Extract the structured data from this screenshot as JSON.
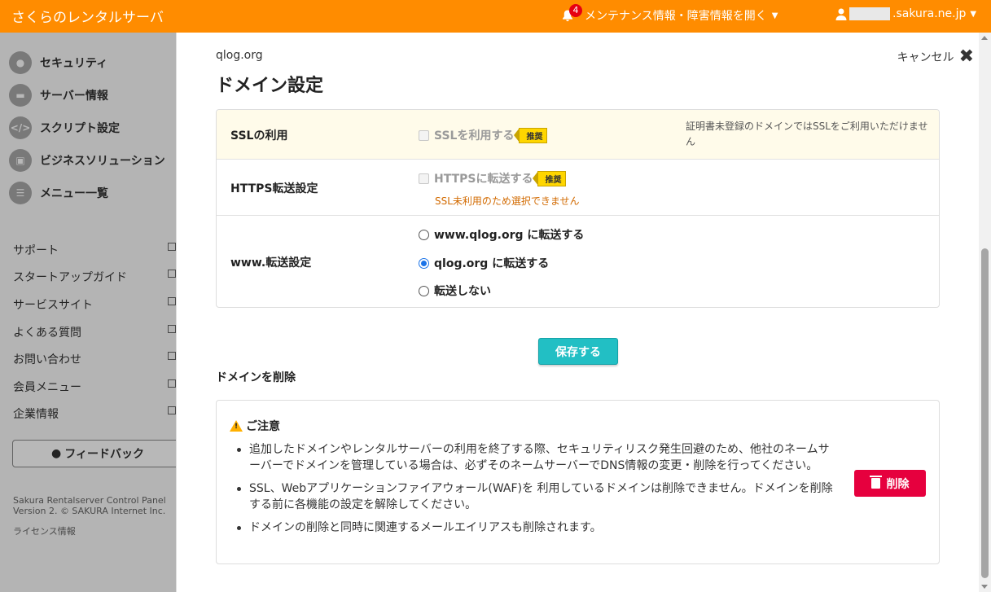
{
  "topbar": {
    "brand": "さくらのレンタルサーバ",
    "notification_count": "4",
    "notice_link": "メンテナンス情報・障害情報を開く",
    "account_suffix": ".sakura.ne.jp"
  },
  "sidebar": {
    "items": [
      {
        "label": "セキュリティ"
      },
      {
        "label": "サーバー情報"
      },
      {
        "label": "スクリプト設定"
      },
      {
        "label": "ビジネスソリューション"
      },
      {
        "label": "メニュー一覧"
      }
    ],
    "links": [
      "サポート",
      "スタートアップガイド",
      "サービスサイト",
      "よくある質問",
      "お問い合わせ",
      "会員メニュー",
      "企業情報"
    ],
    "feedback": "フィードバック",
    "footer_line1": "Sakura Rentalserver Control Panel",
    "footer_line2": "Version 2. © SAKURA Internet Inc.",
    "license": "ライセンス情報"
  },
  "modal": {
    "breadcrumb": "qlog.org",
    "title": "ドメイン設定",
    "cancel": "キャンセル",
    "ssl": {
      "label": "SSLの利用",
      "option": "SSLを利用する",
      "tag": "推奨",
      "note": "証明書未登録のドメインではSSLをご利用いただけません"
    },
    "https": {
      "label": "HTTPS転送設定",
      "option": "HTTPSに転送する",
      "tag": "推奨",
      "warning": "SSL未利用のため選択できません"
    },
    "www": {
      "label": "www.転送設定",
      "options": [
        {
          "label": "www.qlog.org に転送する",
          "selected": false
        },
        {
          "label": "qlog.org に転送する",
          "selected": true
        },
        {
          "label": "転送しない",
          "selected": false
        }
      ]
    },
    "save": "保存する",
    "delete_heading": "ドメインを削除",
    "caution": {
      "title": "ご注意",
      "items": [
        "追加したドメインやレンタルサーバーの利用を終了する際、セキュリティリスク発生回避のため、他社のネームサーバーでドメインを管理している場合は、必ずそのネームサーバーでDNS情報の変更・削除を行ってください。",
        "SSL、Webアプリケーションファイアウォール(WAF)を 利用しているドメインは削除できません。ドメインを削除する前に各機能の設定を解除してください。",
        "ドメインの削除と同時に関連するメールエイリアスも削除されます。"
      ]
    },
    "delete_button": "削除"
  },
  "colors": {
    "topbar": "#ff8c00",
    "save_button": "#22bfc4",
    "delete_button": "#e6003e",
    "warning_text": "#d26a00",
    "recommend_tag": "#ffd600",
    "radio_selected": "#1a73e8"
  }
}
